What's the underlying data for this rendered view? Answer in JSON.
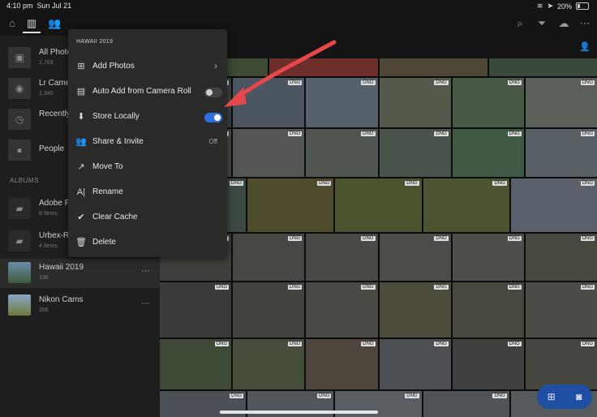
{
  "status_bar": {
    "time": "4:10 pm",
    "date": "Sun Jul 21",
    "battery": "20%"
  },
  "top_bar": {
    "icons": [
      "home-icon",
      "library-icon",
      "people-icon",
      "search-icon",
      "filter-icon",
      "cloud-icon",
      "more-icon"
    ]
  },
  "sidebar": {
    "items": [
      {
        "title": "All Photos",
        "count": "1,703"
      },
      {
        "title": "Lr Camera",
        "count": "1,340"
      },
      {
        "title": "Recently",
        "count": ""
      },
      {
        "title": "People",
        "count": ""
      }
    ],
    "albums_heading": "ALBUMS",
    "albums": [
      {
        "title": "Adobe P",
        "count": "8 Items"
      },
      {
        "title": "Urbex-Ru",
        "count": "4 Items"
      },
      {
        "title": "Hawaii 2019",
        "count": "136"
      },
      {
        "title": "Nikon Cams",
        "count": "356"
      }
    ]
  },
  "context_menu": {
    "title": "HAWAII 2019",
    "items": [
      {
        "label": "Add Photos",
        "icon": "add-photos-icon",
        "right": "›"
      },
      {
        "label": "Auto Add from Camera Roll",
        "icon": "camera-roll-icon",
        "toggle": false
      },
      {
        "label": "Store Locally",
        "icon": "store-locally-icon",
        "toggle": true
      },
      {
        "label": "Share & Invite",
        "icon": "share-icon",
        "right": "Off"
      },
      {
        "label": "Move To",
        "icon": "move-icon"
      },
      {
        "label": "Rename",
        "icon": "rename-icon"
      },
      {
        "label": "Clear Cache",
        "icon": "clear-cache-icon"
      },
      {
        "label": "Delete",
        "icon": "trash-icon"
      }
    ]
  },
  "grid": {
    "badge": "DNG"
  },
  "colors": {
    "accent": "#2f6fde",
    "arrow": "#e8474c",
    "fab": "#1f4fa3"
  }
}
